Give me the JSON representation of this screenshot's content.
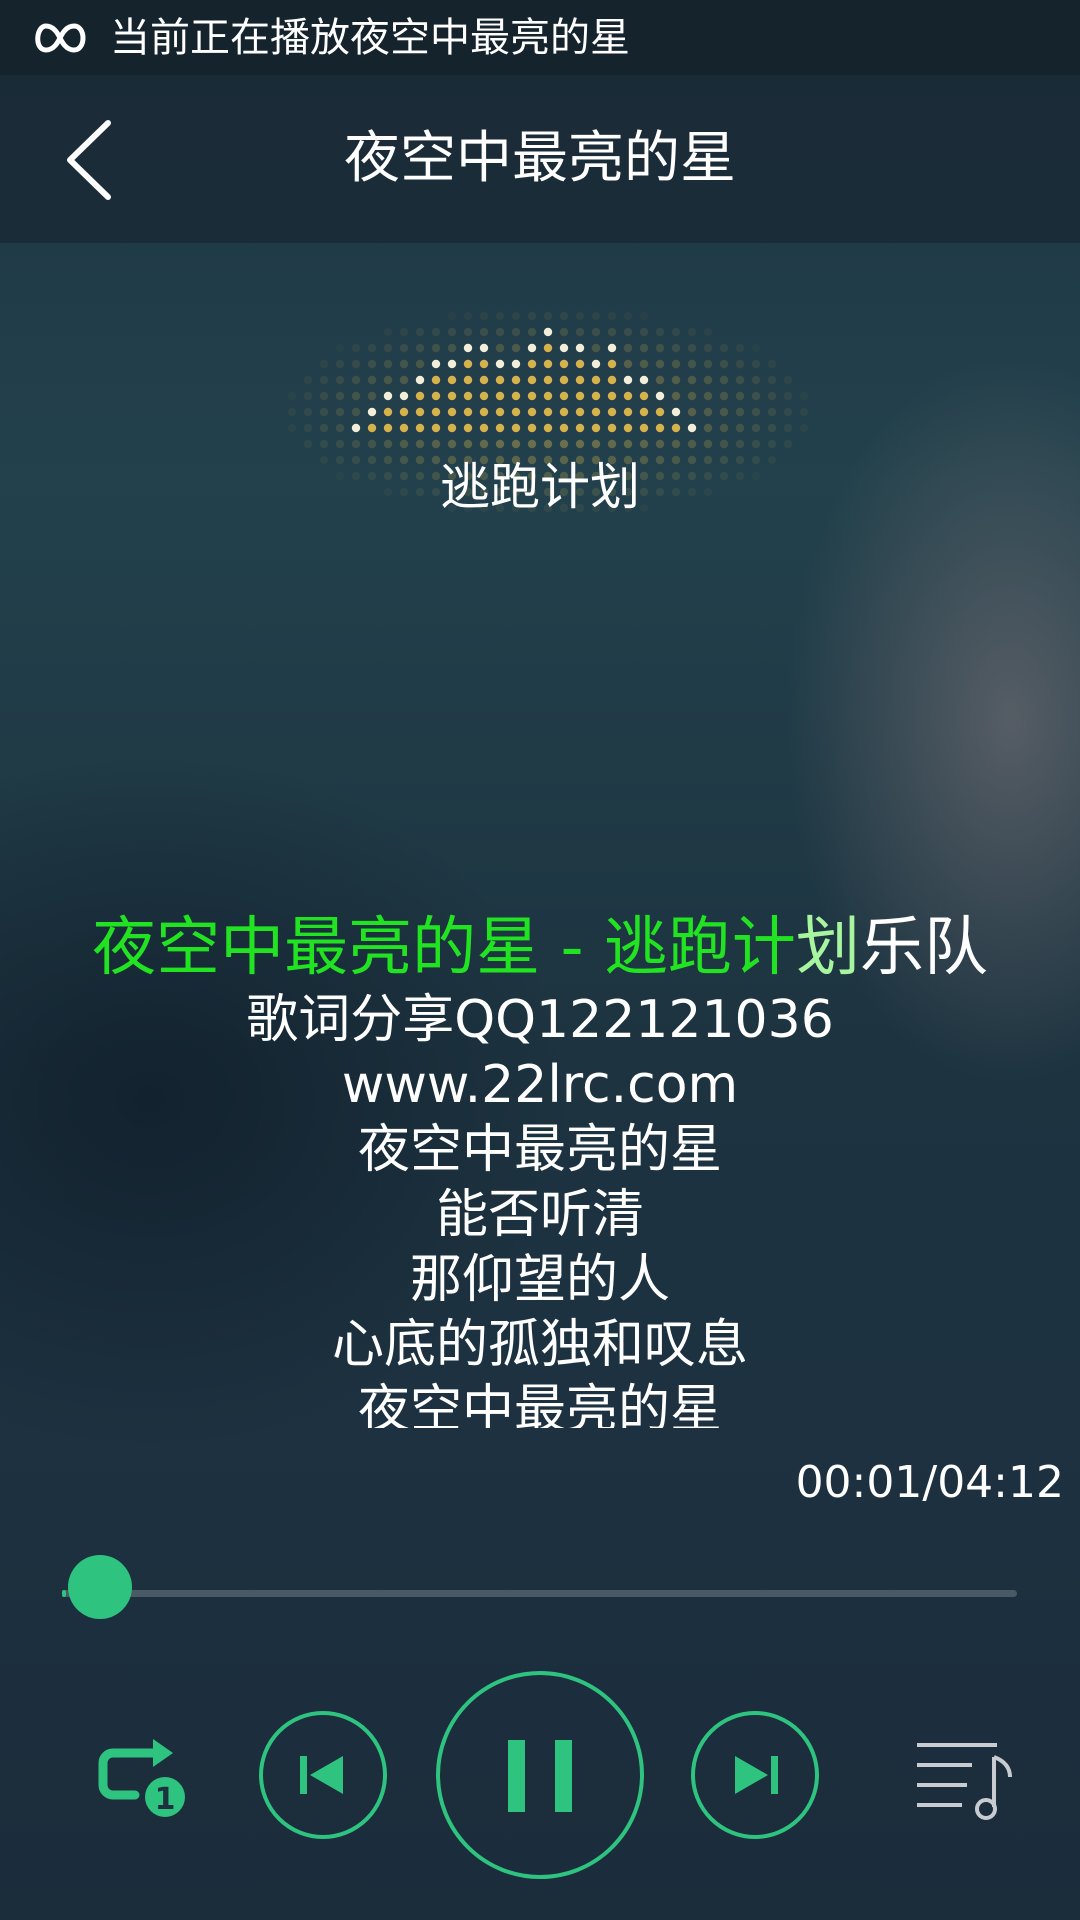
{
  "status_bar": {
    "icon": "infinity-icon",
    "text": "当前正在播放夜空中最亮的星"
  },
  "header": {
    "back_icon": "chevron-left-icon",
    "title": "夜空中最亮的星"
  },
  "visualizer": {
    "icon": "equalizer-dots-icon",
    "color": "#e0b84a"
  },
  "artist": "逃跑计划",
  "lyrics": {
    "current_line": {
      "sung": "夜空中最亮的星 - 逃跑计",
      "fading": "划",
      "rest": "乐队"
    },
    "lines": [
      "歌词分享QQ122121036",
      "www.22lrc.com",
      "夜空中最亮的星",
      "能否听清",
      "那仰望的人",
      "心底的孤独和叹息",
      "夜空中最亮的星"
    ]
  },
  "player": {
    "time_display": "00:01/04:12",
    "progress_fraction": 0.004,
    "accent_color": "#2ec480",
    "controls": {
      "repeat_icon": "repeat-one-icon",
      "prev_icon": "skip-previous-icon",
      "pause_icon": "pause-icon",
      "next_icon": "skip-next-icon",
      "playlist_icon": "playlist-music-icon"
    }
  }
}
